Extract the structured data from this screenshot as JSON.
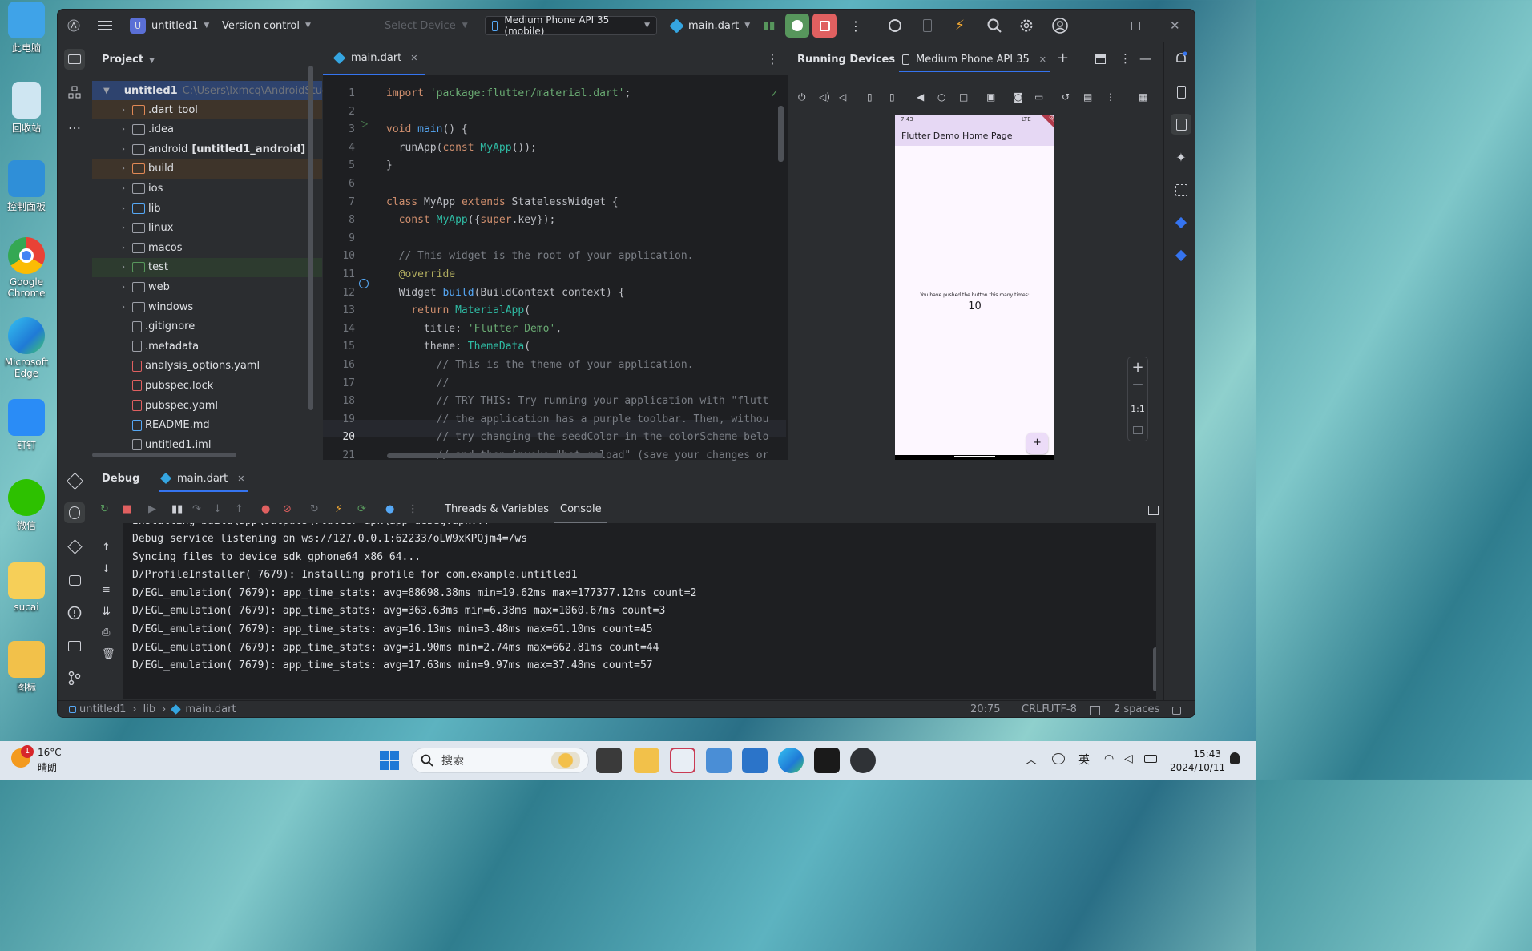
{
  "desktop": {
    "icons": [
      "此电脑",
      "回收站",
      "控制面板",
      "Google Chrome",
      "Microsoft Edge",
      "钉钉",
      "微信",
      "sucai",
      "图标"
    ]
  },
  "titlebar": {
    "project_badge": "U",
    "project": "untitled1",
    "vcs": "Version control",
    "select_device": "Select Device",
    "device": "Medium Phone API 35 (mobile)",
    "run_config": "main.dart"
  },
  "project_panel": {
    "title": "Project",
    "root": "untitled1",
    "root_path": "C:\\Users\\lxmcq\\AndroidStud",
    "items": [
      {
        "name": ".dart_tool",
        "kind": "folder-orange",
        "expand": true
      },
      {
        "name": ".idea",
        "kind": "folder",
        "expand": true
      },
      {
        "name": "android",
        "extra": "[untitled1_android]",
        "kind": "folder",
        "expand": true
      },
      {
        "name": "build",
        "kind": "folder-orange",
        "expand": true
      },
      {
        "name": "ios",
        "kind": "folder",
        "expand": true
      },
      {
        "name": "lib",
        "kind": "folder-blue",
        "expand": true
      },
      {
        "name": "linux",
        "kind": "folder",
        "expand": true
      },
      {
        "name": "macos",
        "kind": "folder",
        "expand": true
      },
      {
        "name": "test",
        "kind": "folder-green",
        "expand": true
      },
      {
        "name": "web",
        "kind": "folder",
        "expand": true
      },
      {
        "name": "windows",
        "kind": "folder",
        "expand": true
      },
      {
        "name": ".gitignore",
        "kind": "ignore",
        "expand": false
      },
      {
        "name": ".metadata",
        "kind": "text",
        "expand": false
      },
      {
        "name": "analysis_options.yaml",
        "kind": "yaml",
        "expand": false
      },
      {
        "name": "pubspec.lock",
        "kind": "yaml",
        "expand": false
      },
      {
        "name": "pubspec.yaml",
        "kind": "yaml",
        "expand": false
      },
      {
        "name": "README.md",
        "kind": "md",
        "expand": false
      },
      {
        "name": "untitled1.iml",
        "kind": "iml",
        "expand": false
      }
    ]
  },
  "editor": {
    "tab": "main.dart",
    "current_line": "20",
    "lines": [
      {
        "n": "1",
        "t": "import 'package:flutter/material.dart';"
      },
      {
        "n": "2",
        "t": ""
      },
      {
        "n": "3",
        "t": "void main() {"
      },
      {
        "n": "4",
        "t": "  runApp(const MyApp());"
      },
      {
        "n": "5",
        "t": "}"
      },
      {
        "n": "6",
        "t": ""
      },
      {
        "n": "7",
        "t": "class MyApp extends StatelessWidget {"
      },
      {
        "n": "8",
        "t": "  const MyApp({super.key});"
      },
      {
        "n": "9",
        "t": ""
      },
      {
        "n": "10",
        "t": "  // This widget is the root of your application."
      },
      {
        "n": "11",
        "t": "  @override"
      },
      {
        "n": "12",
        "t": "  Widget build(BuildContext context) {"
      },
      {
        "n": "13",
        "t": "    return MaterialApp("
      },
      {
        "n": "14",
        "t": "      title: 'Flutter Demo',"
      },
      {
        "n": "15",
        "t": "      theme: ThemeData("
      },
      {
        "n": "16",
        "t": "        // This is the theme of your application."
      },
      {
        "n": "17",
        "t": "        //"
      },
      {
        "n": "18",
        "t": "        // TRY THIS: Try running your application with \"flutt"
      },
      {
        "n": "19",
        "t": "        // the application has a purple toolbar. Then, withou"
      },
      {
        "n": "20",
        "t": "        // try changing the seedColor in the colorScheme belo"
      },
      {
        "n": "21",
        "t": "        // and then invoke \"hot reload\" (save your changes or"
      }
    ]
  },
  "devices": {
    "title": "Running Devices",
    "tab": "Medium Phone API 35",
    "phone": {
      "time": "7:43",
      "network": "LTE",
      "app_title": "Flutter Demo Home Page",
      "message": "You have pushed the button this many times:",
      "counter": "10",
      "fab": "+",
      "debug_banner": "DEBUG"
    },
    "zoom_label": "1:1"
  },
  "debug": {
    "title": "Debug",
    "tab": "main.dart",
    "tabs": [
      "Threads & Variables",
      "Console"
    ],
    "console": [
      "Debug service listening on ws://127.0.0.1:62233/oLW9xKPQjm4=/ws",
      "Syncing files to device sdk gphone64 x86 64...",
      "D/ProfileInstaller( 7679): Installing profile for com.example.untitled1",
      "D/EGL_emulation( 7679): app_time_stats: avg=88698.38ms min=19.62ms max=177377.12ms count=2",
      "D/EGL_emulation( 7679): app_time_stats: avg=363.63ms min=6.38ms max=1060.67ms count=3",
      "D/EGL_emulation( 7679): app_time_stats: avg=16.13ms min=3.48ms max=61.10ms count=45",
      "D/EGL_emulation( 7679): app_time_stats: avg=31.90ms min=2.74ms max=662.81ms count=44",
      "D/EGL_emulation( 7679): app_time_stats: avg=17.63ms min=9.97ms max=37.48ms count=57"
    ]
  },
  "statusbar": {
    "crumbs": [
      "untitled1",
      "lib",
      "main.dart"
    ],
    "position": "20:75",
    "line_sep": "CRLF",
    "encoding": "UTF-8",
    "indent": "2 spaces"
  },
  "taskbar": {
    "weather_temp": "16°C",
    "weather_desc": "晴朗",
    "weather_badge": "1",
    "search": "搜索",
    "ime": "英",
    "time": "15:43",
    "date": "2024/10/11"
  }
}
